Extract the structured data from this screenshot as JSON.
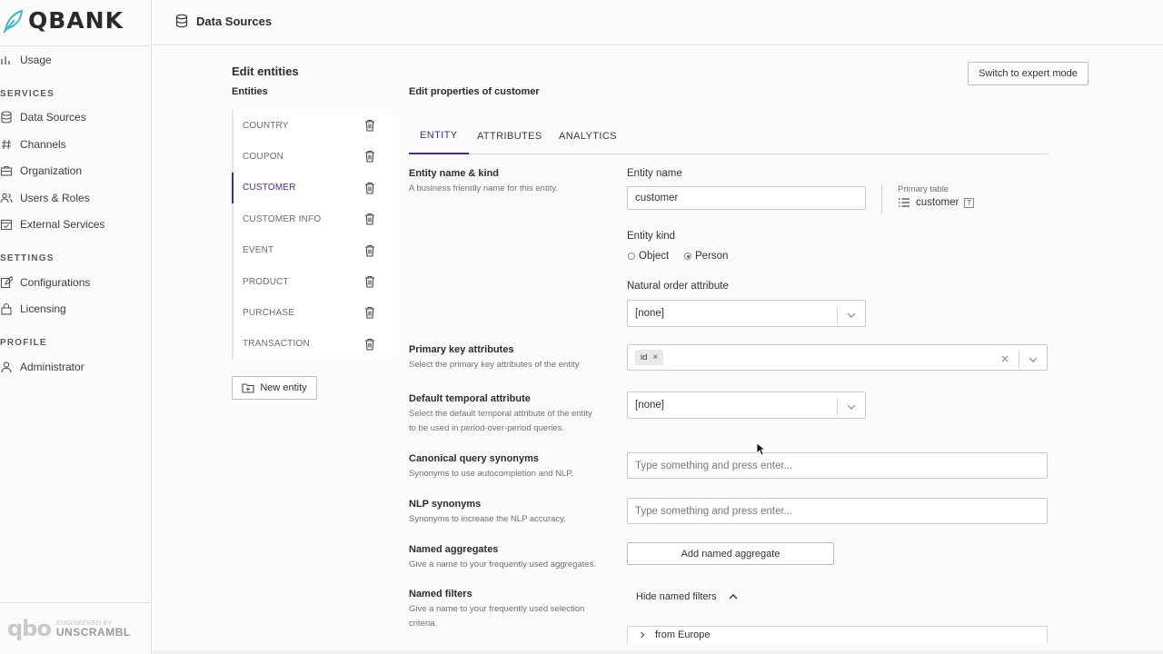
{
  "brand": {
    "name": "QBANK"
  },
  "header": {
    "title": "Data Sources"
  },
  "sidebar": {
    "usage": "Usage",
    "sections": [
      {
        "title": "SERVICES",
        "items": [
          "Data Sources",
          "Channels",
          "Organization",
          "Users & Roles",
          "External Services"
        ]
      },
      {
        "title": "SETTINGS",
        "items": [
          "Configurations",
          "Licensing"
        ]
      },
      {
        "title": "PROFILE",
        "items": [
          "Administrator"
        ]
      }
    ],
    "footer": {
      "qbo": "qbo",
      "engineered_by": "ENGINEERED BY",
      "company": "UNSCRAMBL"
    }
  },
  "page": {
    "title": "Edit entities",
    "entities_label": "Entities",
    "expert_mode_button": "Switch to expert mode",
    "new_entity_button": "New entity",
    "entities": [
      "COUNTRY",
      "COUPON",
      "CUSTOMER",
      "CUSTOMER INFO",
      "EVENT",
      "PRODUCT",
      "PURCHASE",
      "TRANSACTION"
    ],
    "active_entity": "CUSTOMER"
  },
  "editor": {
    "title": "Edit properties of customer",
    "tabs": [
      "ENTITY",
      "ATTRIBUTES",
      "ANALYTICS"
    ],
    "active_tab": "ENTITY",
    "sections": {
      "name_kind": {
        "title": "Entity name & kind",
        "desc": "A business friendly name for this entity."
      },
      "primary_key": {
        "title": "Primary key attributes",
        "desc": "Select the primary key attributes of the entity"
      },
      "temporal": {
        "title": "Default temporal attribute",
        "desc": "Select the default temporal attribute of the entity to be used in period-over-period queries."
      },
      "canonical": {
        "title": "Canonical query synonyms",
        "desc": "Synonyms to use autocompletion and NLP."
      },
      "nlp": {
        "title": "NLP synonyms",
        "desc": "Synonyms to increase the NLP accuracy."
      },
      "aggregates": {
        "title": "Named aggregates",
        "desc": "Give a name to your frequently used aggregates."
      },
      "filters": {
        "title": "Named filters",
        "desc": "Give a name to your frequently used selection criteria."
      }
    },
    "entity_name_label": "Entity name",
    "entity_name_value": "customer",
    "primary_table_label": "Primary table",
    "primary_table_value": "customer",
    "primary_table_badge": "T",
    "entity_kind_label": "Entity kind",
    "kind_options": [
      "Object",
      "Person"
    ],
    "kind_selected": "Person",
    "natural_order_label": "Natural order attribute",
    "natural_order_value": "[none]",
    "primary_key_tags": [
      "id"
    ],
    "temporal_value": "[none]",
    "canonical_placeholder": "Type something and press enter...",
    "nlp_placeholder": "Type something and press enter...",
    "add_aggregate_button": "Add named aggregate",
    "hide_filters_label": "Hide named filters",
    "filters": [
      "from Europe"
    ]
  },
  "colors": {
    "accent": "#4a2c7a",
    "logo_teal": "#3fb6c4"
  }
}
